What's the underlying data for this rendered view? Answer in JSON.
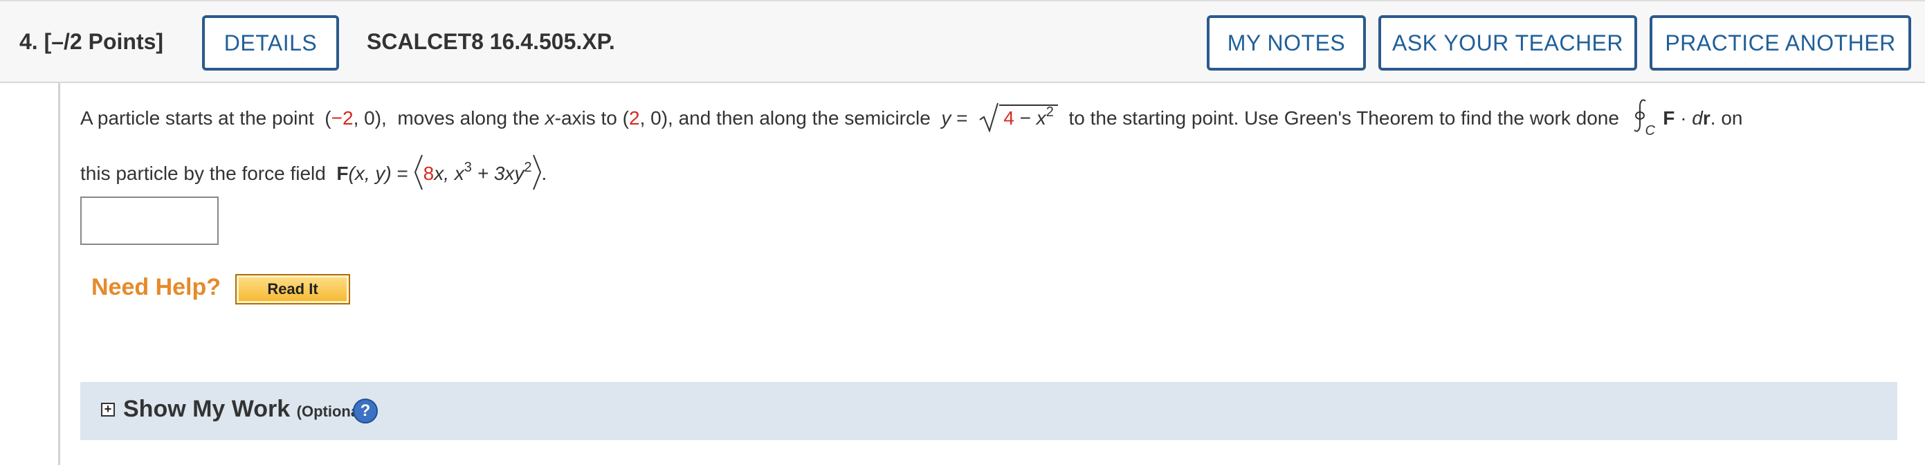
{
  "header": {
    "question_number": "4.",
    "points": "[–/2 Points]",
    "details_label": "DETAILS",
    "question_id": "SCALCET8 16.4.505.XP.",
    "my_notes_label": "MY NOTES",
    "ask_teacher_label": "ASK YOUR TEACHER",
    "practice_label": "PRACTICE ANOTHER"
  },
  "question": {
    "t1": "A particle starts at the point",
    "start_x": "−2",
    "start_rest": ", 0),",
    "t2": "moves along the",
    "x_axis": "x",
    "t3": "-axis to (",
    "end_x": "2",
    "t4": ", 0), and then along the semicircle",
    "y_eq": "y",
    "eq": "=",
    "radicand_num": "4",
    "radicand_minus": " − ",
    "radicand_var": "x",
    "radicand_exp": "2",
    "t5": "to the starting point. Use Green's Theorem to find the work done",
    "integral_sub": "C",
    "F": "F",
    "dot": "·",
    "dr_d": "d",
    "dr_r": "r",
    "t6": ".  on",
    "t7": "this particle by the force field",
    "Fxy_F": "F",
    "Fxy_args": "(x, y)",
    "coef1": "8",
    "comp1_rest": "x, x",
    "exp3": "3",
    "comp2": " + 3xy",
    "exp2": "2",
    "end": "."
  },
  "help": {
    "need_help": "Need Help?",
    "read_it": "Read It"
  },
  "work": {
    "title": "Show My Work",
    "optional": "(Optional)",
    "help_glyph": "?"
  },
  "colors": {
    "accent_blue": "#1f5f99",
    "need_help_orange": "#e58a2a",
    "red_value": "#d62b1f",
    "work_bar": "#dde6ef"
  }
}
